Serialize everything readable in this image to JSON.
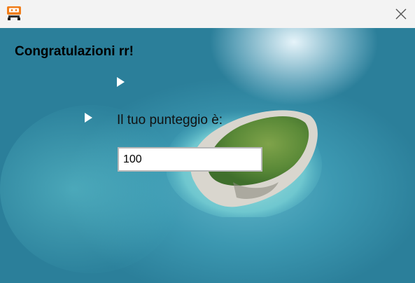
{
  "window": {
    "app_icon": "game-console-icon",
    "close_icon": "close-icon"
  },
  "main": {
    "heading": "Congratulazioni rr!",
    "score_label": "Il tuo punteggio è:",
    "score_value": "100"
  },
  "colors": {
    "titlebar_bg": "#f3f3f3",
    "sea": "#3187a1",
    "input_border": "#b8b8b8"
  }
}
